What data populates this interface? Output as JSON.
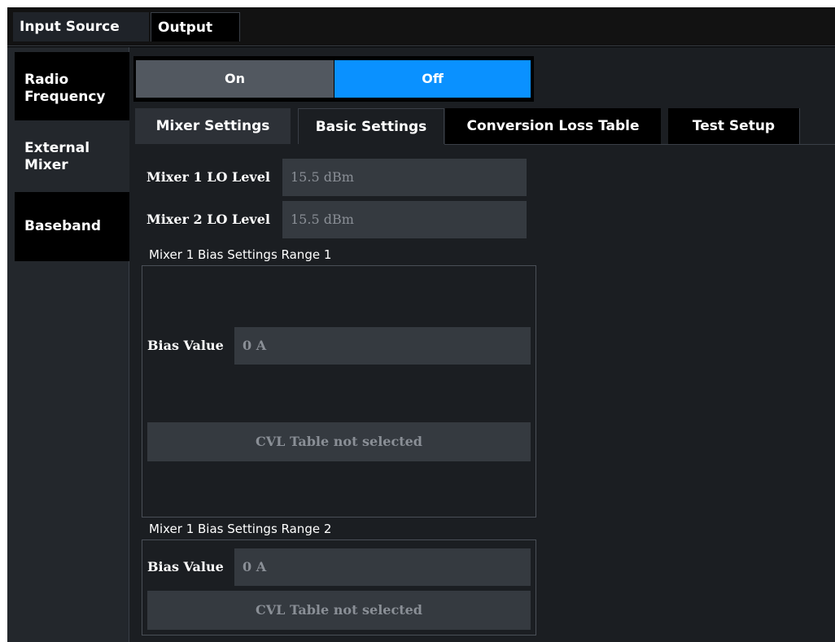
{
  "top_tabs": [
    "Input Source",
    "Output"
  ],
  "left_nav": [
    "Radio Frequency",
    "External Mixer",
    "Baseband"
  ],
  "toggle": {
    "on_label": "On",
    "off_label": "Off",
    "selected": "Off"
  },
  "sub_tabs": [
    "Mixer Settings",
    "Basic Settings",
    "Conversion Loss Table",
    "Test Setup"
  ],
  "fields": {
    "mixer1_lo_label": "Mixer 1 LO Level",
    "mixer1_lo_value": "15.5 dBm",
    "mixer2_lo_label": "Mixer 2 LO Level",
    "mixer2_lo_value": "15.5 dBm"
  },
  "groups": [
    {
      "title": "Mixer 1 Bias Settings Range 1",
      "bias_label": "Bias Value",
      "bias_value": "0 A",
      "cvl_label": "CVL Table not selected"
    },
    {
      "title": "Mixer 1 Bias Settings Range 2",
      "bias_label": "Bias Value",
      "bias_value": "0 A",
      "cvl_label": "CVL Table not selected"
    }
  ],
  "colors": {
    "accent": "#0a91ff",
    "background": "#1b1e22",
    "input_bg": "#353a40",
    "disabled_text": "#8a8f96"
  }
}
